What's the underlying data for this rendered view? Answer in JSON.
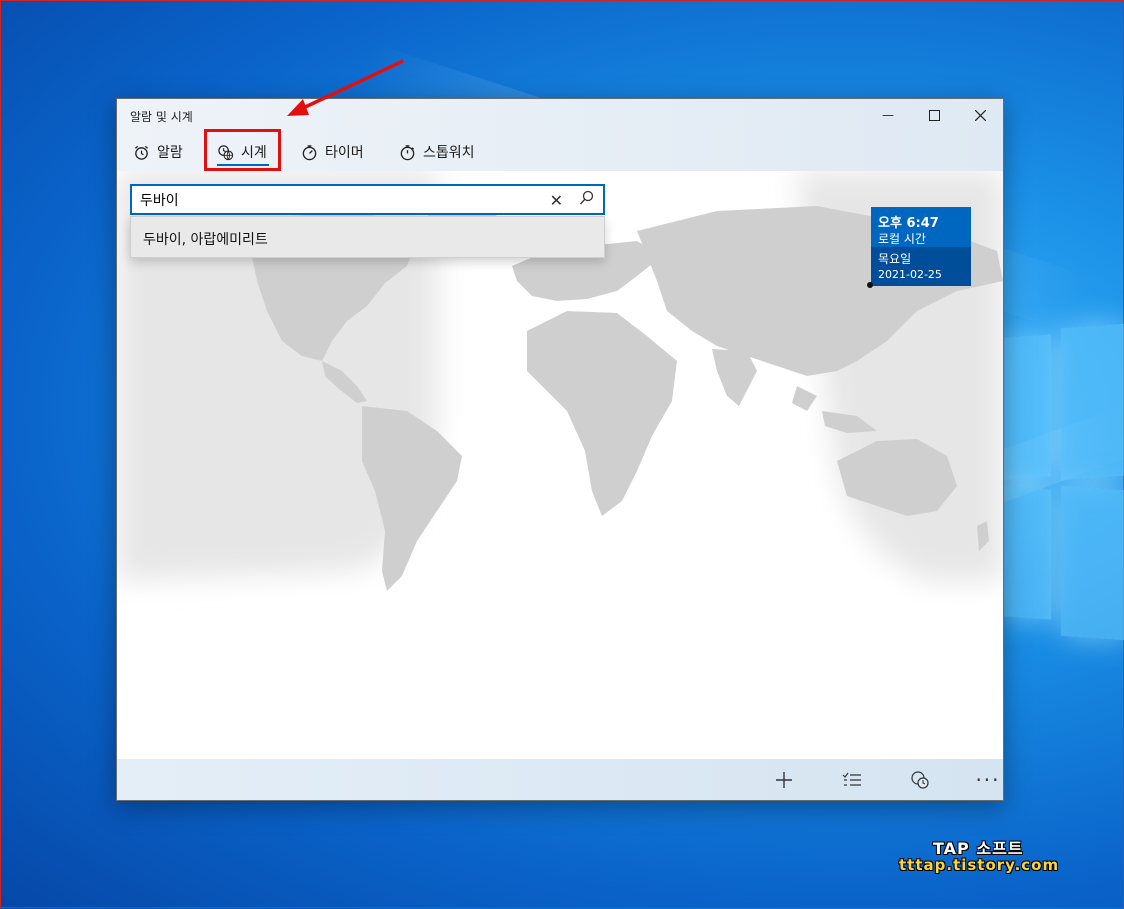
{
  "window": {
    "title": "알람 및 시계",
    "controls": {
      "minimize": "—",
      "maximize": "☐",
      "close": "✕"
    }
  },
  "tabs": [
    {
      "label": "알람",
      "icon": "alarm-clock-icon"
    },
    {
      "label": "시계",
      "icon": "world-clock-icon",
      "selected": true
    },
    {
      "label": "타이머",
      "icon": "timer-icon"
    },
    {
      "label": "스톱워치",
      "icon": "stopwatch-icon"
    }
  ],
  "search": {
    "value": "두바이",
    "suggestion": "두바이, 아랍에미리트"
  },
  "local_card": {
    "time": "오후 6:47",
    "label": "로컬 시간",
    "weekday": "목요일",
    "date": "2021-02-25"
  },
  "footer": {
    "icons": [
      "add-icon",
      "select-list-icon",
      "compare-clock-icon",
      "more-icon"
    ]
  },
  "watermark": {
    "line1": "TAP 소프트",
    "line2": "tttap.tistory.com"
  },
  "colors": {
    "accent": "#0067c0",
    "highlight_box": "#e01010",
    "card_dark": "#004d99"
  }
}
